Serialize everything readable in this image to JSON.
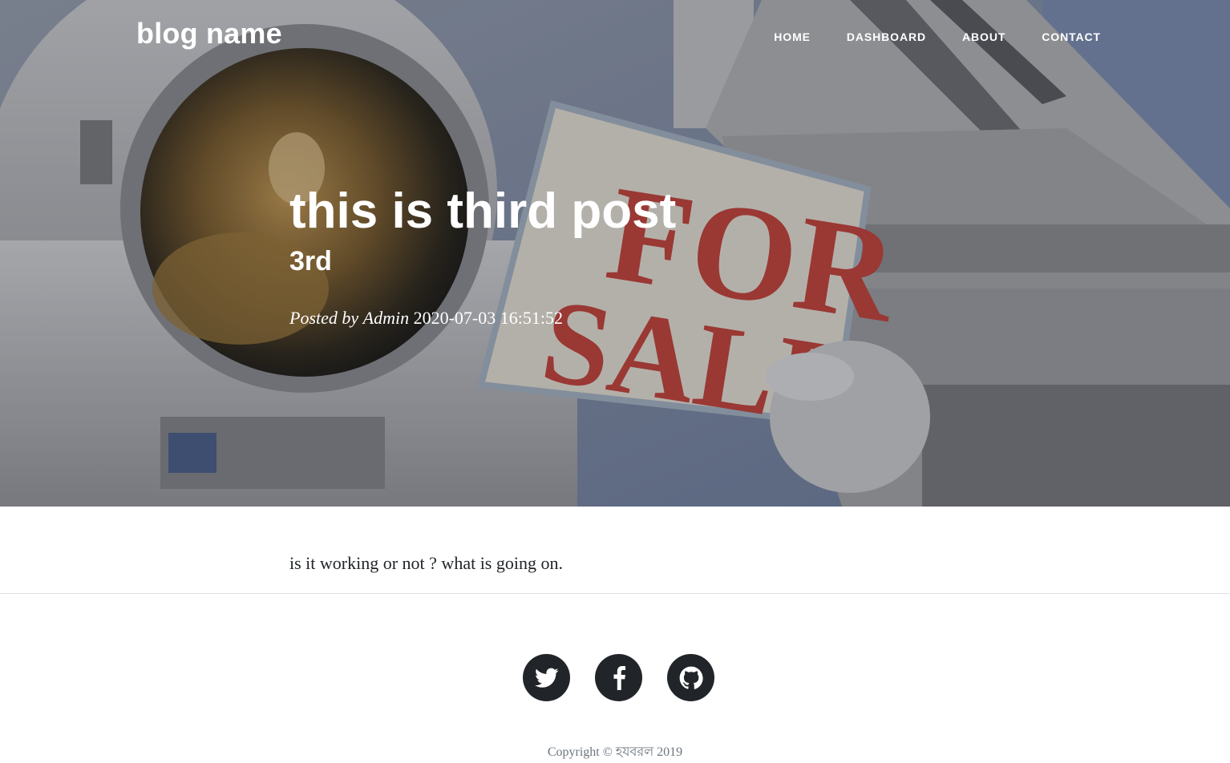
{
  "site": {
    "brand": "blog name"
  },
  "nav": {
    "items": [
      {
        "label": "Home"
      },
      {
        "label": "Dashboard"
      },
      {
        "label": "About"
      },
      {
        "label": "Contact"
      }
    ]
  },
  "post": {
    "title": "this is third post",
    "subtitle": "3rd",
    "meta_prefix": "Posted by",
    "author": "Admin",
    "date": "2020-07-03 16:51:52",
    "body": "is it working or not ? what is going on.",
    "hero_sign_line1": "FOR",
    "hero_sign_line2": "SALE"
  },
  "footer": {
    "social": [
      {
        "name": "twitter",
        "icon": "twitter-icon"
      },
      {
        "name": "facebook",
        "icon": "facebook-icon"
      },
      {
        "name": "github",
        "icon": "github-icon"
      }
    ],
    "copyright": "Copyright © হযবরল 2019"
  },
  "colors": {
    "dark": "#212529",
    "muted": "#6c757d",
    "white": "#ffffff",
    "sign_red": "#c9403a"
  }
}
